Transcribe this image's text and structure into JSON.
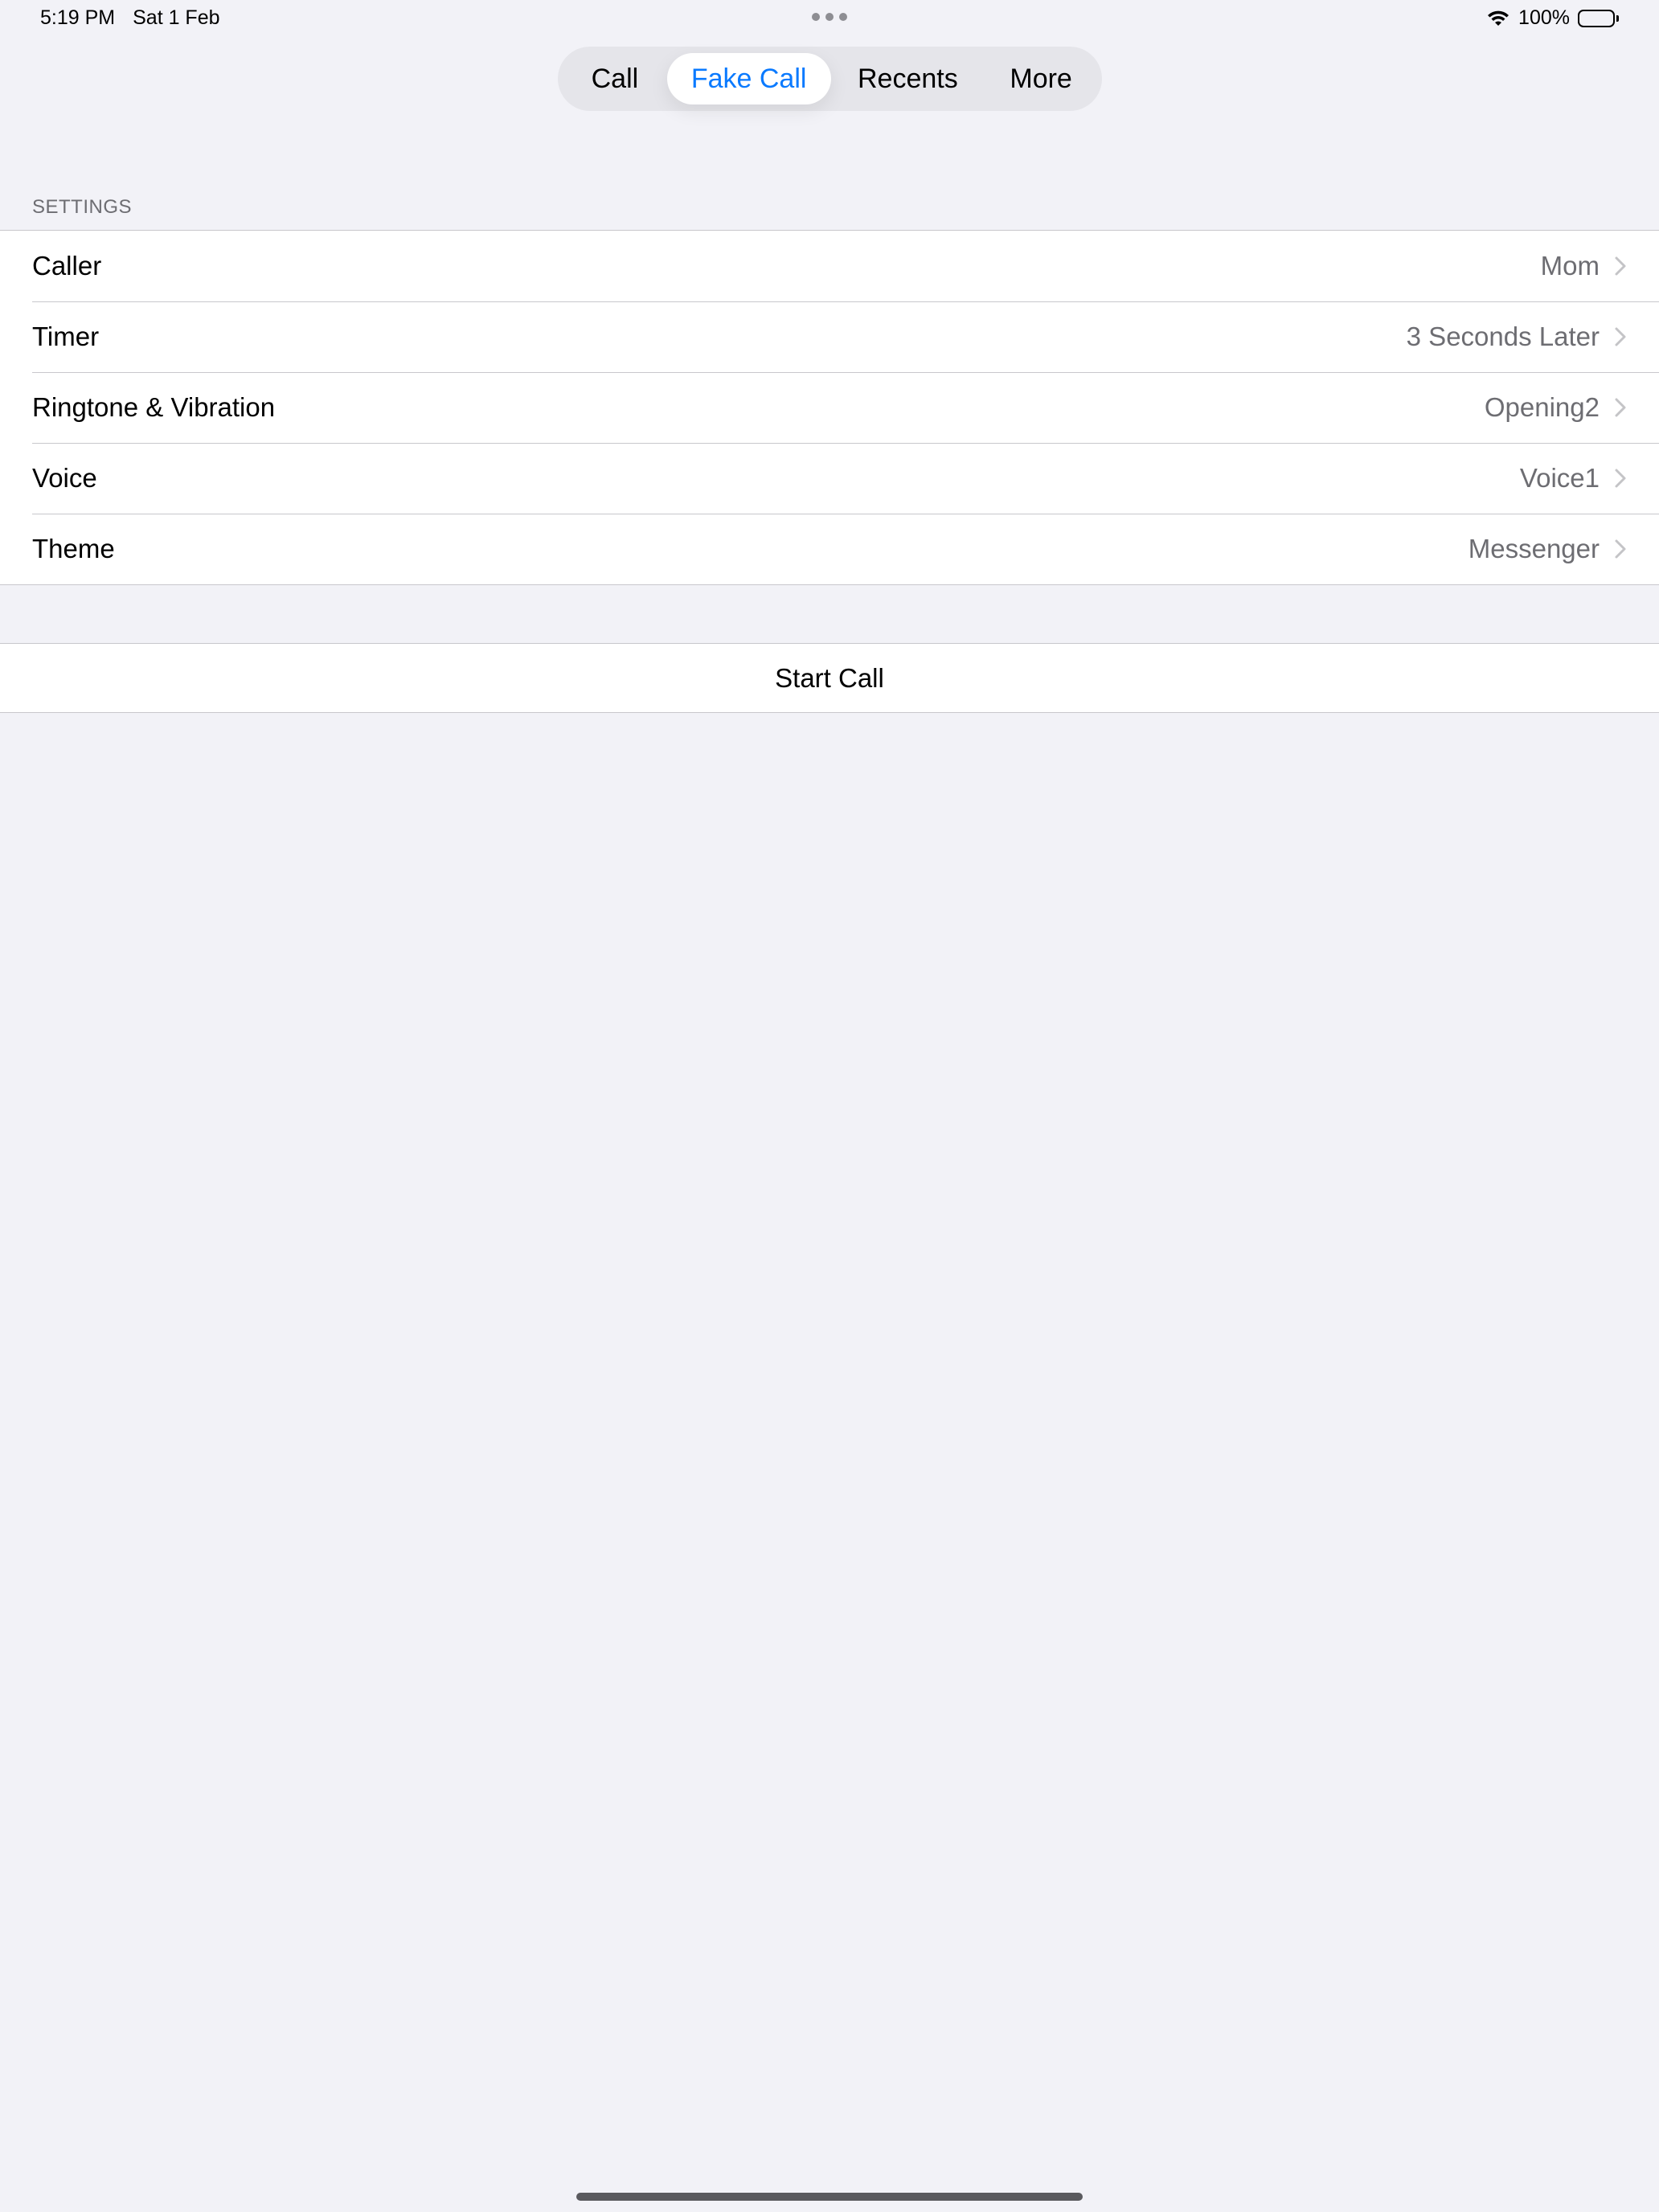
{
  "status_bar": {
    "time": "5:19 PM",
    "date": "Sat 1 Feb",
    "battery": "100%",
    "battery_level": 1.0
  },
  "tabs": [
    {
      "label": "Call",
      "selected": false
    },
    {
      "label": "Fake Call",
      "selected": true
    },
    {
      "label": "Recents",
      "selected": false
    },
    {
      "label": "More",
      "selected": false
    }
  ],
  "settings": {
    "header": "SETTINGS",
    "rows": [
      {
        "label": "Caller",
        "value": "Mom"
      },
      {
        "label": "Timer",
        "value": "3 Seconds Later"
      },
      {
        "label": "Ringtone & Vibration",
        "value": "Opening2"
      },
      {
        "label": "Voice",
        "value": "Voice1"
      },
      {
        "label": "Theme",
        "value": "Messenger"
      }
    ]
  },
  "start_call": {
    "label": "Start Call"
  },
  "colors": {
    "accent": "#0a7aff",
    "background": "#f2f2f7",
    "secondary_text": "#6d6d72"
  }
}
